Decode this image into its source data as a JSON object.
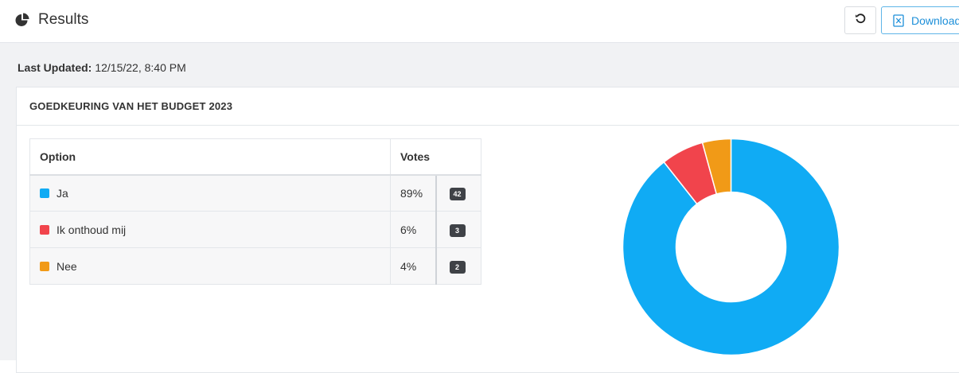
{
  "header": {
    "title": "Results",
    "download_label": "Download"
  },
  "status": {
    "last_updated_label": "Last Updated:",
    "last_updated_value": "12/15/22, 8:40 PM"
  },
  "poll": {
    "title": "GOEDKEURING VAN HET BUDGET 2023",
    "columns": {
      "option": "Option",
      "votes": "Votes"
    },
    "rows": [
      {
        "label": "Ja",
        "percent": "89%",
        "count": "42",
        "color": "#10abf4"
      },
      {
        "label": "Ik onthoud mij",
        "percent": "6%",
        "count": "3",
        "color": "#f1444c"
      },
      {
        "label": "Nee",
        "percent": "4%",
        "count": "2",
        "color": "#f19a17"
      }
    ]
  },
  "chart_data": {
    "type": "pie",
    "categories": [
      "Ja",
      "Ik onthoud mij",
      "Nee"
    ],
    "values": [
      42,
      3,
      2
    ],
    "colors": [
      "#10abf4",
      "#f1444c",
      "#f19a17"
    ],
    "donut": true
  }
}
